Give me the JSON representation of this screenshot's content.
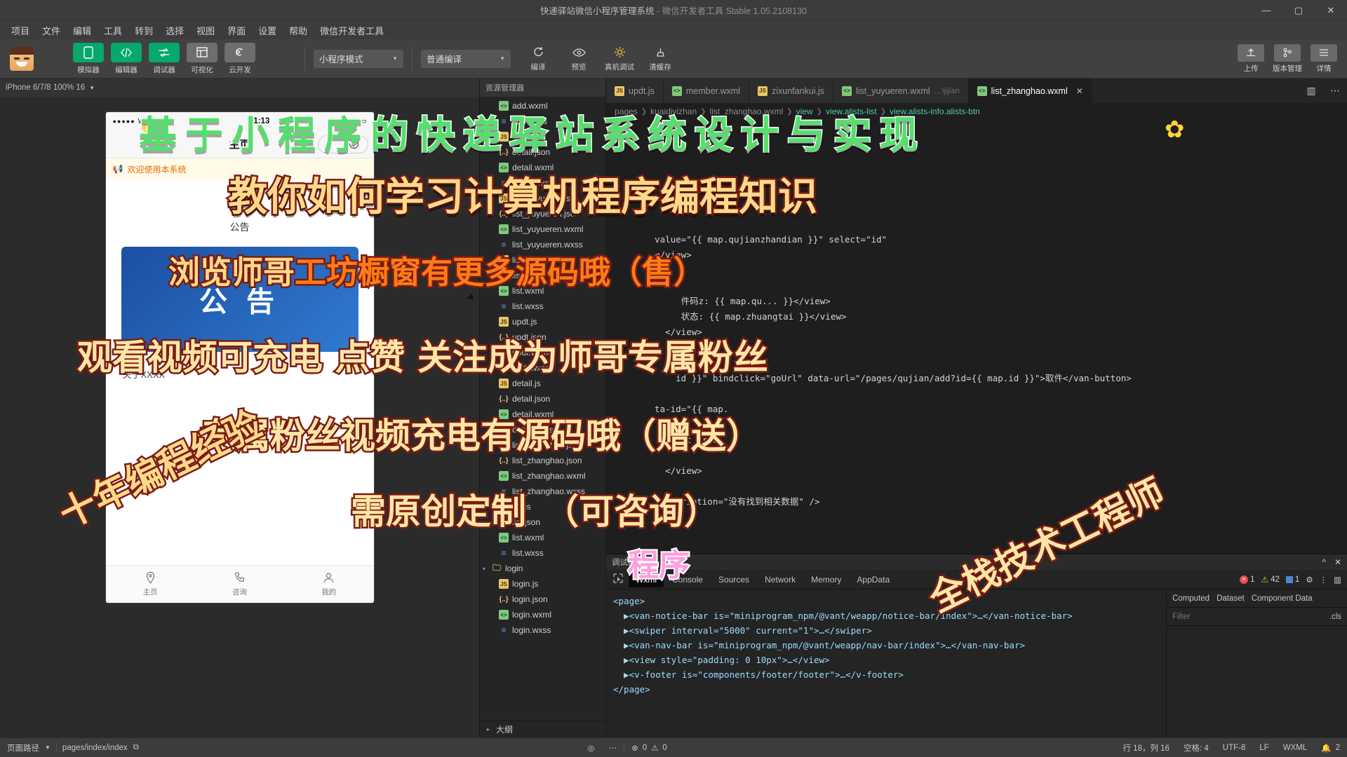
{
  "window": {
    "title": "快递驿站微信小程序管理系统",
    "title_sep": "-",
    "subtitle": "微信开发者工具 Stable 1.05.2108130",
    "minimize": "—",
    "maximize": "▢",
    "close": "✕"
  },
  "menubar": {
    "items": [
      "项目",
      "文件",
      "编辑",
      "工具",
      "转到",
      "选择",
      "视图",
      "界面",
      "设置",
      "帮助",
      "微信开发者工具"
    ]
  },
  "toolbar": {
    "panel_buttons": [
      {
        "label": "模拟器",
        "icon": "phone-icon",
        "style": "green"
      },
      {
        "label": "编辑器",
        "icon": "code-icon",
        "style": "green"
      },
      {
        "label": "调试器",
        "icon": "debug-icon",
        "style": "green"
      },
      {
        "label": "可视化",
        "icon": "layout-icon",
        "style": "grey"
      },
      {
        "label": "云开发",
        "icon": "cloud-icon",
        "style": "grey"
      }
    ],
    "mode_select": "小程序模式",
    "compile_select": "普通编译",
    "actions": [
      {
        "label": "编译",
        "icon": "refresh-icon"
      },
      {
        "label": "预览",
        "icon": "eye-icon"
      },
      {
        "label": "真机调试",
        "icon": "device-debug-icon"
      },
      {
        "label": "清缓存",
        "icon": "broom-icon"
      }
    ],
    "right_actions": [
      {
        "label": "上传",
        "icon": "upload-icon"
      },
      {
        "label": "版本管理",
        "icon": "branch-icon"
      },
      {
        "label": "详情",
        "icon": "menu-icon"
      }
    ]
  },
  "simulator": {
    "device_label": "iPhone 6/7/8 100% 16",
    "phone": {
      "carrier_dots": "●●●●●",
      "carrier": "WeChat",
      "time": "1:13",
      "battery": "▭",
      "nav_title": "主页",
      "notice": "欢迎使用本系统",
      "section_title": "公告",
      "hero_text": "公 告",
      "about_text": "关于XXXX",
      "tabs": [
        {
          "label": "主页",
          "icon": "location-icon"
        },
        {
          "label": "咨询",
          "icon": "phone-call-icon"
        },
        {
          "label": "我的",
          "icon": "user-icon"
        }
      ]
    },
    "toolbar_icons": [
      "phone-icon",
      "record-icon",
      "volume-icon",
      "window-icon",
      "copy-icon",
      "search-icon",
      "branch-icon",
      "extensions-icon",
      "panel-icon",
      "docker-icon"
    ]
  },
  "filetree": {
    "header": "资源管理器",
    "visible_rows": [
      {
        "name": "add.wxml",
        "type": "wxml",
        "indent": 2
      },
      {
        "name": "add.wxss",
        "type": "wxss",
        "indent": 2
      },
      {
        "name": "detail.js",
        "type": "js",
        "indent": 2
      },
      {
        "name": "detail.json",
        "type": "json",
        "indent": 2
      },
      {
        "name": "detail.wxml",
        "type": "wxml",
        "indent": 2
      },
      {
        "name": "detail.wxss",
        "type": "wxss",
        "indent": 2
      },
      {
        "name": "list_yuyueren.js",
        "type": "js",
        "indent": 2
      },
      {
        "name": "list_yuyueren.json",
        "type": "json",
        "indent": 2
      },
      {
        "name": "list_yuyueren.wxml",
        "type": "wxml",
        "indent": 2
      },
      {
        "name": "list_yuyueren.wxss",
        "type": "wxss",
        "indent": 2
      },
      {
        "name": "list.js",
        "type": "js",
        "indent": 2
      },
      {
        "name": "list.json",
        "type": "json",
        "indent": 2
      },
      {
        "name": "list.wxml",
        "type": "wxml",
        "indent": 2
      },
      {
        "name": "list.wxss",
        "type": "wxss",
        "indent": 2
      },
      {
        "name": "updt.js",
        "type": "js",
        "indent": 2
      },
      {
        "name": "updt.json",
        "type": "json",
        "indent": 2
      },
      {
        "name": "updt.wxml",
        "type": "wxml",
        "indent": 2
      },
      {
        "name": "updt.wxss",
        "type": "wxss",
        "indent": 2
      },
      {
        "name": "detail.js",
        "type": "js",
        "indent": 2
      },
      {
        "name": "detail.json",
        "type": "json",
        "indent": 2
      },
      {
        "name": "detail.wxml",
        "type": "wxml",
        "indent": 2
      },
      {
        "name": "detail.wxss",
        "type": "wxss",
        "indent": 2
      },
      {
        "name": "list_zhanghao.js",
        "type": "js",
        "indent": 2
      },
      {
        "name": "list_zhanghao.json",
        "type": "json",
        "indent": 2
      },
      {
        "name": "list_zhanghao.wxml",
        "type": "wxml",
        "indent": 2
      },
      {
        "name": "list_zhanghao.wxss",
        "type": "wxss",
        "indent": 2
      },
      {
        "name": "list.js",
        "type": "js",
        "indent": 2
      },
      {
        "name": "list.json",
        "type": "json",
        "indent": 2
      },
      {
        "name": "list.wxml",
        "type": "wxml",
        "indent": 2
      },
      {
        "name": "list.wxss",
        "type": "wxss",
        "indent": 2
      },
      {
        "name": "login",
        "type": "folder",
        "indent": 1
      },
      {
        "name": "login.js",
        "type": "js",
        "indent": 2
      },
      {
        "name": "login.json",
        "type": "json",
        "indent": 2
      },
      {
        "name": "login.wxml",
        "type": "wxml",
        "indent": 2
      },
      {
        "name": "login.wxss",
        "type": "wxss",
        "indent": 2
      }
    ],
    "outline_label": "大纲"
  },
  "editor": {
    "tabs": [
      {
        "label": "updt.js",
        "type": "js",
        "active": false
      },
      {
        "label": "member.wxml",
        "type": "wxml",
        "active": false
      },
      {
        "label": "zixunfankui.js",
        "type": "js",
        "active": false
      },
      {
        "label": "list_yuyueren.wxml",
        "type": "wxml",
        "active": false,
        "dim": "…\\jijian"
      },
      {
        "label": "list_zhanghao.wxml",
        "type": "wxml",
        "active": true,
        "close": "✕"
      }
    ],
    "tab_actions": [
      "split-editor-icon",
      "more-icon"
    ],
    "breadcrumb": [
      "pages",
      "kuaidiyizhan",
      "list_zhanghao.wxml",
      "view",
      "view.alists-list",
      "view.alists-info.alists-btn"
    ],
    "code_lines": [
      {
        "n": "",
        "text": ""
      },
      {
        "n": "",
        "text": ""
      },
      {
        "n": "",
        "text": ""
      },
      {
        "n": "",
        "text": ""
      },
      {
        "n": "",
        "text": ""
      },
      {
        "n": "",
        "text": ""
      },
      {
        "n": "",
        "text": ""
      },
      {
        "n": "",
        "text": "  value=\"{{ map.qujianzhandian }}\" select=\"id\""
      },
      {
        "n": "",
        "text": "  </view>"
      },
      {
        "n": "",
        "text": ""
      },
      {
        "n": "",
        "text": ""
      },
      {
        "n": "",
        "text": "       件码z: {{ map.qu... }}</view>"
      },
      {
        "n": "",
        "text": "       状态: {{ map.zhuangtai }}</view>"
      },
      {
        "n": "",
        "text": "    </view>"
      },
      {
        "n": "",
        "text": ""
      },
      {
        "n": "",
        "text": ""
      },
      {
        "n": "",
        "text": "      id }}\" bindclick=\"goUrl\" data-url=\"/pages/qujian/add?id={{ map.id }}\">取件</van-button>"
      },
      {
        "n": "",
        "text": ""
      },
      {
        "n": "",
        "text": "  ta-id=\"{{ map."
      },
      {
        "n": "",
        "text": ""
      },
      {
        "n": "",
        "text": "      ght  rdo"
      },
      {
        "n": "",
        "text": ""
      },
      {
        "n": "",
        "text": "    </view>"
      },
      {
        "n": "",
        "text": ""
      },
      {
        "n": "",
        "text": "   description=\"没有找到相关数据\" />"
      }
    ]
  },
  "devtools": {
    "title": "调试器",
    "collapse_icon": "^",
    "close_icon": "✕",
    "tabs": [
      "Wxml",
      "Console",
      "Sources",
      "Network",
      "Memory",
      "AppData"
    ],
    "active_tab": "Wxml",
    "inspect_icon": "inspect-icon",
    "error_count": "1",
    "warning_count": "42",
    "info_count": "1",
    "settings_icon": "gear-icon",
    "more_icon": "more-icon",
    "dock_icon": "dock-icon",
    "dom_lines": [
      "<page>",
      "  ▶<van-notice-bar is=\"miniprogram_npm/@vant/weapp/notice-bar/index\">…</van-notice-bar>",
      "  ▶<swiper interval=\"5000\" current=\"1\">…</swiper>",
      "  ▶<van-nav-bar is=\"miniprogram_npm/@vant/weapp/nav-bar/index\">…</van-nav-bar>",
      "  ▶<view style=\"padding: 0 10px\">…</view>",
      "  ▶<v-footer is=\"components/footer/footer\">…</v-footer>",
      "</page>"
    ],
    "side_tabs": [
      "Computed",
      "Dataset",
      "Component Data"
    ],
    "filter_placeholder": "Filter",
    "filter_cls": ".cls"
  },
  "statusbar": {
    "page_path_label": "页面路径",
    "page_path": "pages/index/index",
    "copy_icon": "copy-icon",
    "eye_icon": "eye-icon",
    "more_icon": "more-icon",
    "problems_error": "0",
    "problems_warning": "0",
    "cursor": "行 18，列 16",
    "indent": "空格: 4",
    "encoding": "UTF-8",
    "eol": "LF",
    "language": "WXML",
    "bell_icon": "bell-icon",
    "bell_count": "2"
  },
  "overlay": {
    "line1": "基于小程序的快递驿站系统设计与实现",
    "line2": "教你如何学习计算机程序编程知识",
    "line3_a": "浏览师哥",
    "line3_b": "工坊橱窗有更多源码哦（售）",
    "line4": "观看视频可充电  点赞  关注成为师哥专属粉丝",
    "line5": "专属粉丝视频充电有源码哦（赠送）",
    "line6": "需原创定制　（可咨询）",
    "corner_left": "十年编程经验",
    "corner_right": "全栈技术工程师",
    "center_small": "程序",
    "flower": "✿"
  }
}
